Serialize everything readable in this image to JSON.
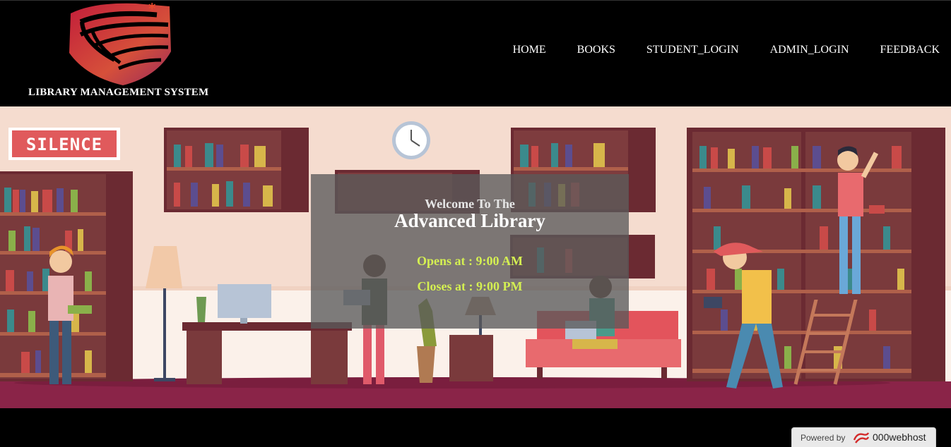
{
  "header": {
    "site_title": "LIBRARY MANAGEMENT SYSTEM",
    "logo_icon": "shield-logo-icon"
  },
  "nav": {
    "items": [
      {
        "label": "HOME"
      },
      {
        "label": "BOOKS"
      },
      {
        "label": "STUDENT_LOGIN"
      },
      {
        "label": "ADMIN_LOGIN"
      },
      {
        "label": "FEEDBACK"
      }
    ]
  },
  "hero": {
    "sign_text": "SILENCE",
    "welcome_line": "Welcome To The",
    "library_name": "Advanced Library",
    "opens": "Opens at : 9:00 AM",
    "closes": "Closes at : 9:00 PM"
  },
  "footer": {
    "powered_by": "Powered by",
    "brand": "000webhost"
  },
  "colors": {
    "accent_text": "#d4ef52",
    "header_bg": "#000000",
    "floor": "#8a2448"
  }
}
